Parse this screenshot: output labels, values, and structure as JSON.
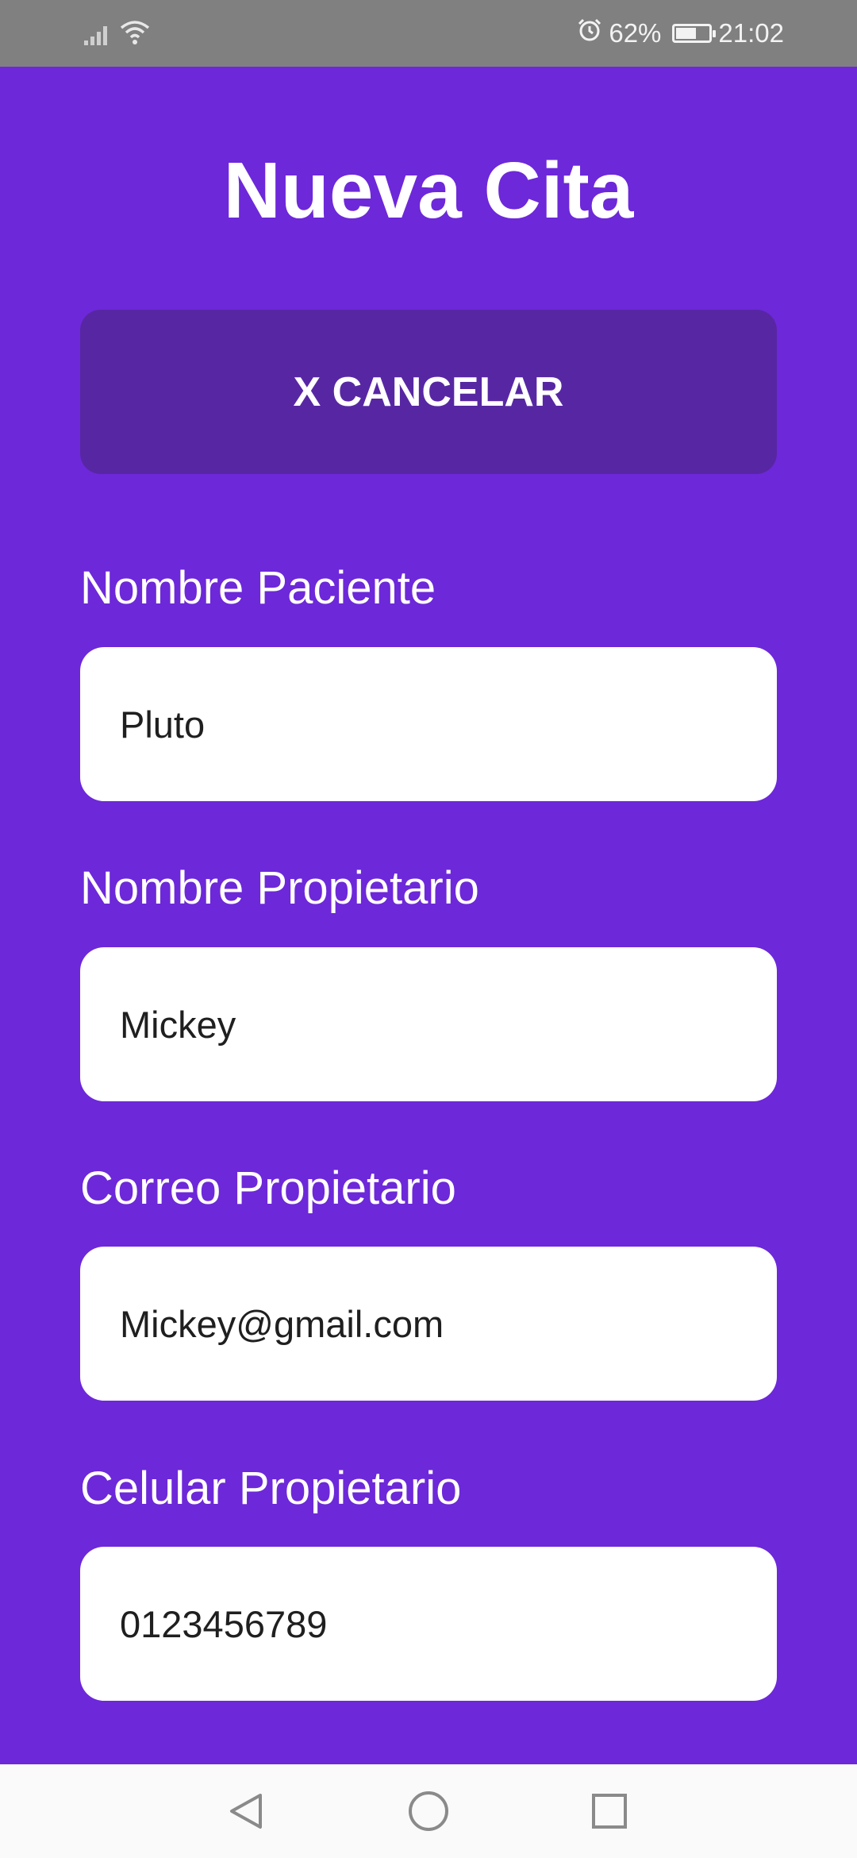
{
  "status_bar": {
    "battery_percent": "62%",
    "battery_level": 0.62,
    "time": "21:02",
    "icons": [
      "signal-icon",
      "wifi-icon",
      "alarm-icon",
      "battery-icon"
    ]
  },
  "header": {
    "title": "Nueva Cita"
  },
  "actions": {
    "cancel_label": "X CANCELAR"
  },
  "form": {
    "fields": [
      {
        "label": "Nombre Paciente",
        "value": "Pluto"
      },
      {
        "label": "Nombre Propietario",
        "value": "Mickey"
      },
      {
        "label": "Correo Propietario",
        "value": "Mickey@gmail.com"
      },
      {
        "label": "Celular Propietario",
        "value": "0123456789"
      }
    ]
  },
  "navigation": {
    "icons": [
      "back-icon",
      "home-icon",
      "recents-icon"
    ]
  },
  "colors": {
    "background": "#6D28D9",
    "cancel_button": "#5727A3",
    "status_bar": "#808080",
    "input_background": "#FFFFFF"
  }
}
